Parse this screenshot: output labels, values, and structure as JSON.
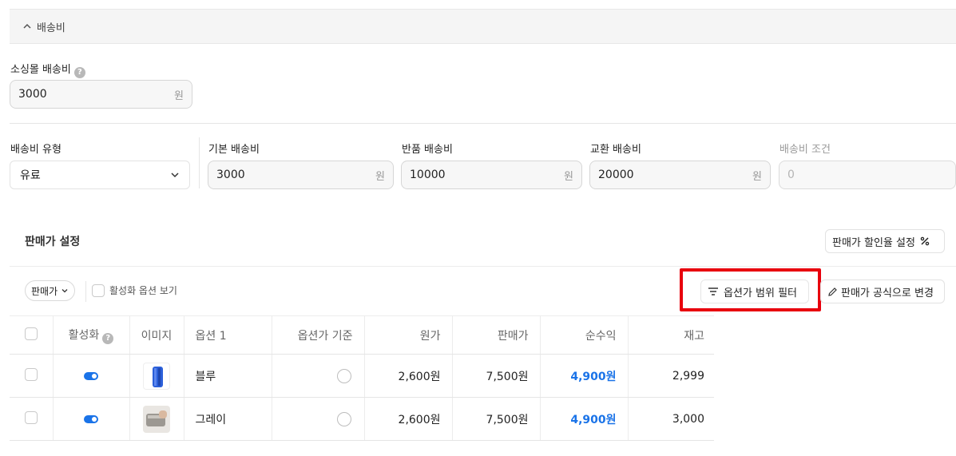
{
  "accordion": {
    "title": "배송비"
  },
  "mall_shipping": {
    "label": "소싱몰 배송비",
    "value": "3000",
    "unit": "원"
  },
  "shipping": {
    "type_label": "배송비 유형",
    "type_value": "유료",
    "base_label": "기본 배송비",
    "base_value": "3000",
    "return_label": "반품 배송비",
    "return_value": "10000",
    "exchange_label": "교환 배송비",
    "exchange_value": "20000",
    "condition_label": "배송비 조건",
    "condition_placeholder": "0",
    "unit": "원"
  },
  "price_settings": {
    "title": "판매가 설정",
    "discount_button": "판매가 할인율 설정",
    "price_select": "판매가",
    "show_inactive_label": "활성화 옵션 보기",
    "range_filter_button": "옵션가 범위 필터",
    "formula_button": "판매가 공식으로 변경"
  },
  "table": {
    "headers": {
      "active": "활성화",
      "image": "이미지",
      "option1": "옵션 1",
      "option_base": "옵션가 기준",
      "cost": "원가",
      "price": "판매가",
      "profit": "순수익",
      "stock": "재고"
    },
    "rows": [
      {
        "option": "블루",
        "cost": "2,600원",
        "price": "7,500원",
        "profit": "4,900원",
        "stock": "2,999"
      },
      {
        "option": "그레이",
        "cost": "2,600원",
        "price": "7,500원",
        "profit": "4,900원",
        "stock": "3,000"
      }
    ]
  },
  "colors": {
    "accent": "#1a73e8",
    "highlight": "#e8000d"
  }
}
